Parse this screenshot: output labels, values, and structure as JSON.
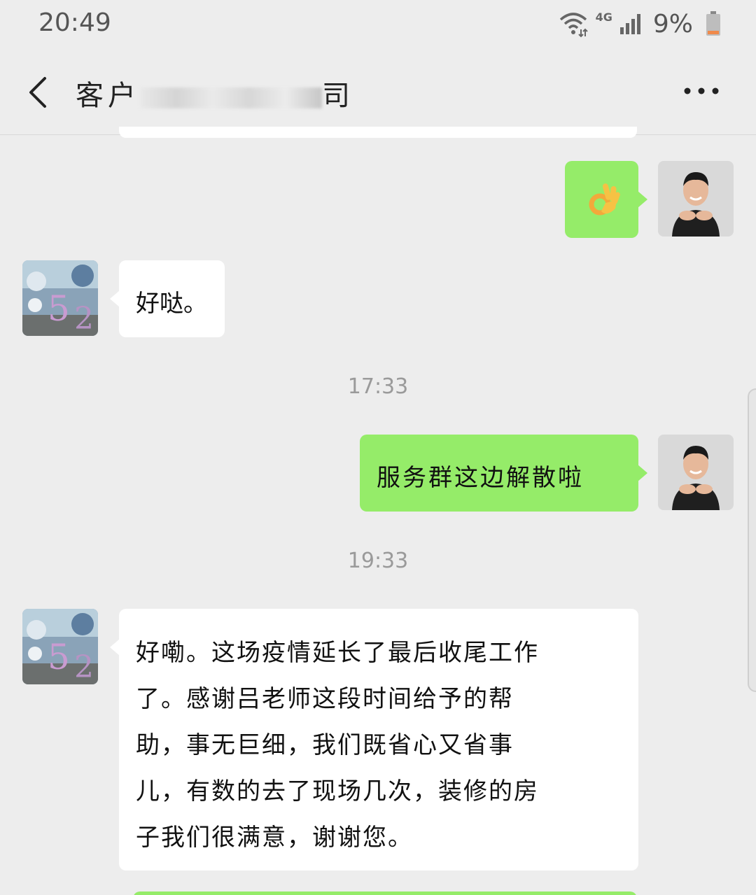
{
  "status_bar": {
    "time": "20:49",
    "network": "4G",
    "battery": "9%"
  },
  "header": {
    "title": "客户",
    "title_tail": "司"
  },
  "messages": {
    "m1": {
      "side": "right",
      "kind": "emoji",
      "emoji": "👌"
    },
    "m2": {
      "side": "left",
      "text": "好哒。"
    },
    "ts1": "17:33",
    "m3": {
      "side": "right",
      "text": "服务群这边解散啦"
    },
    "ts2": "19:33",
    "m4": {
      "side": "left",
      "lines": [
        "好嘞。这场疫情延长了最后收尾工作",
        "了。感谢吕老师这段时间给予的帮",
        "助，事无巨细，我们既省心又省事",
        "儿，有数的去了现场几次，装修的房",
        "子我们很满意，谢谢您。"
      ]
    }
  },
  "colors": {
    "background": "#ededed",
    "outgoing_bubble": "#95ec69",
    "incoming_bubble": "#ffffff",
    "timestamp": "#9a9a9a"
  }
}
